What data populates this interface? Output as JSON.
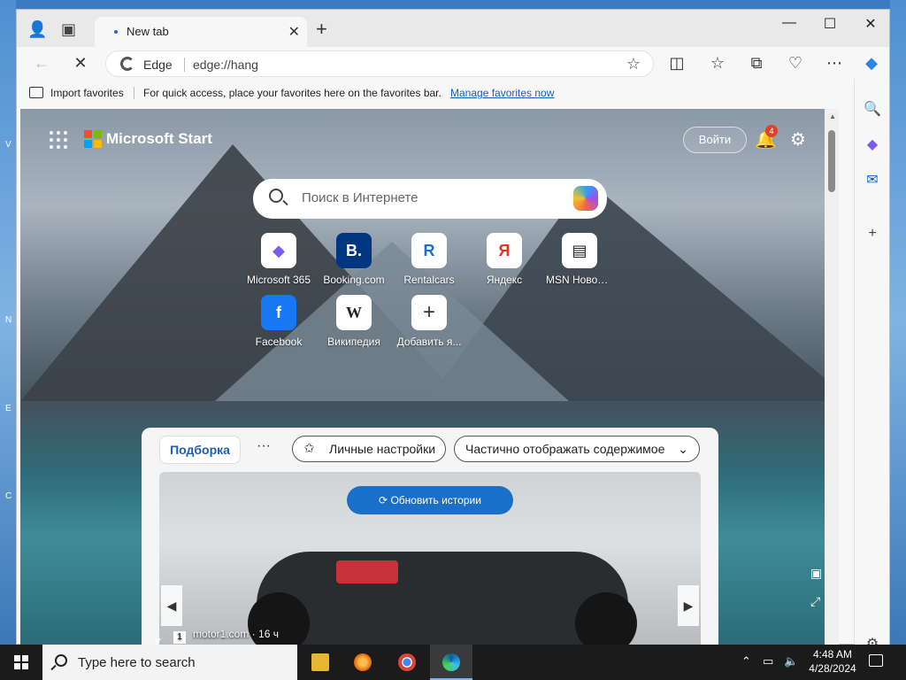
{
  "desktop": {
    "left_letters": [
      "V",
      "N",
      "E",
      "C"
    ]
  },
  "browser": {
    "tab": {
      "title": "New tab",
      "close": "✕"
    },
    "new_tab": "+",
    "window_controls": {
      "minimize": "—",
      "maximize": "☐",
      "close": "✕"
    },
    "address": {
      "site_label": "Edge",
      "url": "edge://hang"
    },
    "favorites_bar": {
      "import_label": "Import favorites",
      "message": "For quick access, place your favorites here on the favorites bar.",
      "manage_link": "Manage favorites now"
    }
  },
  "page": {
    "brand": "Microsoft Start",
    "signin": "Войти",
    "notification_count": "4",
    "search_placeholder": "Поиск в Интернете",
    "tiles": [
      {
        "label": "Microsoft 365",
        "glyph": "◆",
        "color": "#7b5cf0"
      },
      {
        "label": "Booking.com",
        "glyph": "B.",
        "color": "#003580"
      },
      {
        "label": "Rentalcars",
        "glyph": "R",
        "color": "#1a6fc8"
      },
      {
        "label": "Яндекс",
        "glyph": "Я",
        "color": "#e6332a"
      },
      {
        "label": "MSN Новости",
        "glyph": "▤",
        "color": "#222222"
      },
      {
        "label": "Facebook",
        "glyph": "f",
        "color": "#1877f2"
      },
      {
        "label": "Википедия",
        "glyph": "W",
        "color": "#222222"
      },
      {
        "label": "Добавить я...",
        "glyph": "+",
        "color": "#333333"
      }
    ],
    "feed": {
      "active_tab": "Подборка",
      "more": "···",
      "personalize": "Личные настройки",
      "content_mode": "Частично отображать содержимое",
      "refresh": "Обновить истории",
      "source": "motor1.com · 16 ч",
      "source_logo": "1"
    }
  },
  "taskbar": {
    "search_placeholder": "Type here to search",
    "time": "4:48 AM",
    "date": "4/28/2024"
  },
  "colors": {
    "accent": "#1a6fc8",
    "taskbar": "#1b1b1b"
  }
}
